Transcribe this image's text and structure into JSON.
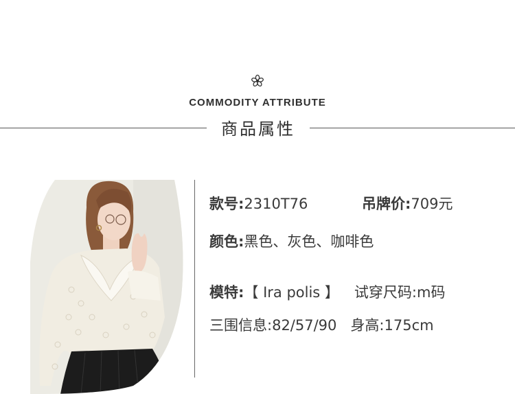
{
  "header": {
    "en_title": "COMMODITY ATTRIBUTE",
    "cn_title": "商品属性"
  },
  "attributes": {
    "style_no_label": "款号:",
    "style_no_value": "2310T76",
    "price_label": "吊牌价:",
    "price_value": "709元",
    "color_label": "颜色:",
    "color_value": "黑色、灰色、咖啡色",
    "model_label": "模特:",
    "model_value": "【 Ira polis 】",
    "size_label": "试穿尺码:",
    "size_value": "m码",
    "measure_label": "三围信息:",
    "measure_value": "82/57/90",
    "height_label": "身高:",
    "height_value": "175cm"
  },
  "colors": {
    "line": "#555555",
    "text": "#3a3a3a",
    "blouse": "#f1ede2",
    "skirt": "#1c1c1c",
    "hair": "#8a5a3a"
  }
}
